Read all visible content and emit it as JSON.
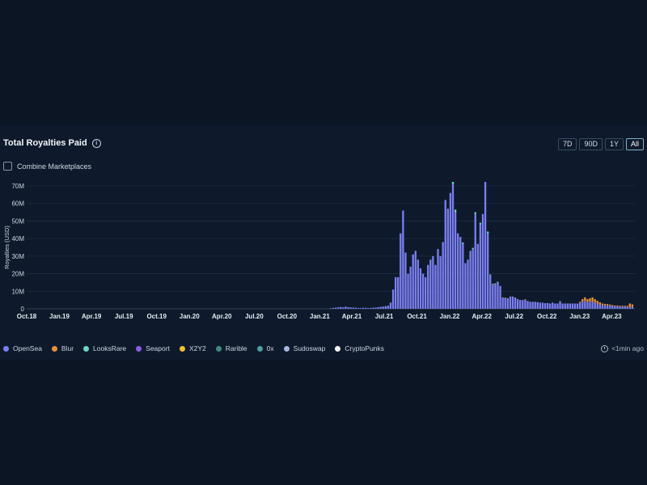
{
  "header": {
    "title": "Total Royalties Paid",
    "info_glyph": "i",
    "ranges": [
      {
        "label": "7D",
        "active": false
      },
      {
        "label": "90D",
        "active": false
      },
      {
        "label": "1Y",
        "active": false
      },
      {
        "label": "All",
        "active": true
      }
    ]
  },
  "combine": {
    "label": "Combine Marketplaces",
    "checked": false
  },
  "footer": {
    "updated": "<1min ago",
    "icon": "clock-refresh-icon"
  },
  "colors": {
    "background": "#0b1524",
    "card": "#0e1a2b",
    "grid": "#1f2d42",
    "OpenSea": "#7b7ff2",
    "Blur": "#e8913b",
    "LooksRare": "#6fd6c6",
    "Seaport": "#8c5ce0",
    "X2Y2": "#f0c02e",
    "Rarible": "#3f8a7c",
    "0x": "#4f9ea1",
    "Sudoswap": "#a7b4de",
    "CryptoPunks": "#f4f4f4"
  },
  "chart_data": {
    "type": "bar",
    "stacked": true,
    "ylabel": "Royalties (USD)",
    "xlabel": "",
    "ylim": [
      0,
      70000000
    ],
    "yticks": [
      {
        "value": 0,
        "label": "0"
      },
      {
        "value": 10000000,
        "label": "10M"
      },
      {
        "value": 20000000,
        "label": "20M"
      },
      {
        "value": 30000000,
        "label": "30M"
      },
      {
        "value": 40000000,
        "label": "40M"
      },
      {
        "value": 50000000,
        "label": "50M"
      },
      {
        "value": 60000000,
        "label": "60M"
      },
      {
        "value": 70000000,
        "label": "70M"
      }
    ],
    "grid": true,
    "xticks": [
      "Oct.18",
      "Jan.19",
      "Apr.19",
      "Jul.19",
      "Oct.19",
      "Jan.20",
      "Apr.20",
      "Jul.20",
      "Oct.20",
      "Jan.21",
      "Apr.21",
      "Jul.21",
      "Oct.21",
      "Jan.22",
      "Apr.22",
      "Jul.22",
      "Oct.22",
      "Jan.23",
      "Apr.23"
    ],
    "x_start": "2018-10-01",
    "x_end": "2023-06-05",
    "bar_interval": "week",
    "legend_position": "bottom",
    "legend": [
      "OpenSea",
      "Blur",
      "LooksRare",
      "Seaport",
      "X2Y2",
      "Rarible",
      "0x",
      "Sudoswap",
      "CryptoPunks"
    ],
    "series": [
      {
        "name": "OpenSea",
        "data": [
          [
            "2021-02-01",
            0.3
          ],
          [
            "2021-02-08",
            0.5
          ],
          [
            "2021-02-15",
            0.6
          ],
          [
            "2021-02-22",
            0.8
          ],
          [
            "2021-03-01",
            1.0
          ],
          [
            "2021-03-08",
            0.8
          ],
          [
            "2021-03-15",
            1.2
          ],
          [
            "2021-03-22",
            0.9
          ],
          [
            "2021-03-29",
            0.8
          ],
          [
            "2021-04-05",
            0.7
          ],
          [
            "2021-04-12",
            0.6
          ],
          [
            "2021-04-19",
            0.5
          ],
          [
            "2021-04-26",
            0.4
          ],
          [
            "2021-05-03",
            0.6
          ],
          [
            "2021-05-10",
            0.5
          ],
          [
            "2021-05-17",
            0.4
          ],
          [
            "2021-05-24",
            0.5
          ],
          [
            "2021-05-31",
            0.6
          ],
          [
            "2021-06-07",
            0.7
          ],
          [
            "2021-06-14",
            0.9
          ],
          [
            "2021-06-21",
            1.1
          ],
          [
            "2021-06-28",
            1.3
          ],
          [
            "2021-07-05",
            1.5
          ],
          [
            "2021-07-12",
            1.8
          ],
          [
            "2021-07-19",
            3.5
          ],
          [
            "2021-07-26",
            11
          ],
          [
            "2021-08-02",
            18
          ],
          [
            "2021-08-09",
            18
          ],
          [
            "2021-08-16",
            43
          ],
          [
            "2021-08-23",
            56
          ],
          [
            "2021-08-30",
            32
          ],
          [
            "2021-09-06",
            20
          ],
          [
            "2021-09-13",
            24
          ],
          [
            "2021-09-20",
            31
          ],
          [
            "2021-09-27",
            33
          ],
          [
            "2021-10-04",
            28
          ],
          [
            "2021-10-11",
            23
          ],
          [
            "2021-10-18",
            20
          ],
          [
            "2021-10-25",
            18
          ],
          [
            "2021-11-01",
            25
          ],
          [
            "2021-11-08",
            28
          ],
          [
            "2021-11-15",
            30
          ],
          [
            "2021-11-22",
            25
          ],
          [
            "2021-11-29",
            34
          ],
          [
            "2021-12-06",
            30
          ],
          [
            "2021-12-13",
            38
          ],
          [
            "2021-12-20",
            62
          ],
          [
            "2021-12-27",
            57
          ],
          [
            "2022-01-03",
            66
          ],
          [
            "2022-01-10",
            71
          ],
          [
            "2022-01-17",
            55
          ],
          [
            "2022-01-24",
            43
          ],
          [
            "2022-01-31",
            41
          ],
          [
            "2022-02-07",
            37
          ],
          [
            "2022-02-14",
            26
          ],
          [
            "2022-02-21",
            28
          ],
          [
            "2022-02-28",
            33
          ],
          [
            "2022-03-07",
            34
          ],
          [
            "2022-03-14",
            54
          ],
          [
            "2022-03-21",
            37
          ],
          [
            "2022-03-28",
            48
          ],
          [
            "2022-04-04",
            54
          ],
          [
            "2022-04-11",
            75
          ],
          [
            "2022-04-18",
            43
          ],
          [
            "2022-04-25",
            19
          ],
          [
            "2022-05-02",
            14
          ],
          [
            "2022-05-09",
            14
          ],
          [
            "2022-05-16",
            15
          ],
          [
            "2022-05-23",
            13
          ],
          [
            "2022-05-30",
            6.5
          ],
          [
            "2022-06-06",
            6
          ],
          [
            "2022-06-13",
            6
          ],
          [
            "2022-06-20",
            7
          ],
          [
            "2022-06-27",
            7
          ],
          [
            "2022-07-04",
            6
          ],
          [
            "2022-07-11",
            5.5
          ],
          [
            "2022-07-18",
            5
          ],
          [
            "2022-07-25",
            5
          ],
          [
            "2022-08-01",
            5
          ],
          [
            "2022-08-08",
            4.5
          ],
          [
            "2022-08-15",
            4
          ],
          [
            "2022-08-22",
            4
          ],
          [
            "2022-08-29",
            4
          ],
          [
            "2022-09-05",
            3.5
          ],
          [
            "2022-09-12",
            3.5
          ],
          [
            "2022-09-19",
            3.5
          ],
          [
            "2022-09-26",
            3.2
          ],
          [
            "2022-10-03",
            3
          ],
          [
            "2022-10-10",
            3
          ],
          [
            "2022-10-17",
            3.5
          ],
          [
            "2022-10-24",
            3
          ],
          [
            "2022-10-31",
            3
          ],
          [
            "2022-11-07",
            4
          ],
          [
            "2022-11-14",
            3
          ],
          [
            "2022-11-21",
            3
          ],
          [
            "2022-11-28",
            3
          ],
          [
            "2022-12-05",
            3
          ],
          [
            "2022-12-12",
            3
          ],
          [
            "2022-12-19",
            3
          ],
          [
            "2022-12-26",
            3
          ],
          [
            "2023-01-02",
            3.5
          ],
          [
            "2023-01-09",
            4
          ],
          [
            "2023-01-16",
            4.5
          ],
          [
            "2023-01-23",
            4
          ],
          [
            "2023-01-30",
            4
          ],
          [
            "2023-02-06",
            4
          ],
          [
            "2023-02-13",
            3.5
          ],
          [
            "2023-02-20",
            3
          ],
          [
            "2023-02-27",
            2.5
          ],
          [
            "2023-03-06",
            2
          ],
          [
            "2023-03-13",
            2
          ],
          [
            "2023-03-20",
            2
          ],
          [
            "2023-03-27",
            1.8
          ],
          [
            "2023-04-03",
            1.6
          ],
          [
            "2023-04-10",
            1.5
          ],
          [
            "2023-04-17",
            1.5
          ],
          [
            "2023-04-24",
            1.3
          ],
          [
            "2023-05-01",
            1.2
          ],
          [
            "2023-05-08",
            1.2
          ],
          [
            "2023-05-15",
            1.2
          ],
          [
            "2023-05-22",
            1
          ],
          [
            "2023-05-29",
            1
          ]
        ]
      },
      {
        "name": "LooksRare",
        "data": [
          [
            "2022-01-10",
            2
          ],
          [
            "2022-01-17",
            1.5
          ],
          [
            "2022-02-07",
            0.8
          ],
          [
            "2022-03-07",
            0.7
          ],
          [
            "2022-03-14",
            1
          ],
          [
            "2022-03-28",
            1
          ],
          [
            "2022-04-11",
            1.2
          ],
          [
            "2022-04-18",
            1
          ],
          [
            "2022-04-25",
            0.5
          ],
          [
            "2022-05-09",
            0.5
          ],
          [
            "2022-05-16",
            0.4
          ]
        ]
      },
      {
        "name": "Blur",
        "data": [
          [
            "2023-01-02",
            0.5
          ],
          [
            "2023-01-09",
            1.5
          ],
          [
            "2023-01-16",
            2
          ],
          [
            "2023-01-23",
            1.5
          ],
          [
            "2023-01-30",
            2
          ],
          [
            "2023-02-06",
            2.5
          ],
          [
            "2023-02-13",
            2
          ],
          [
            "2023-02-20",
            1.5
          ],
          [
            "2023-02-27",
            1.2
          ],
          [
            "2023-03-06",
            1
          ],
          [
            "2023-03-13",
            0.8
          ],
          [
            "2023-03-20",
            0.7
          ],
          [
            "2023-03-27",
            0.6
          ],
          [
            "2023-04-03",
            0.5
          ],
          [
            "2023-04-10",
            0.4
          ],
          [
            "2023-04-17",
            0.4
          ],
          [
            "2023-04-24",
            0.4
          ],
          [
            "2023-05-01",
            0.5
          ],
          [
            "2023-05-08",
            0.5
          ],
          [
            "2023-05-15",
            0.5
          ],
          [
            "2023-05-22",
            2
          ],
          [
            "2023-05-29",
            1.5
          ]
        ]
      },
      {
        "name": "X2Y2",
        "data": [
          [
            "2022-05-02",
            0.3
          ],
          [
            "2022-06-06",
            0.3
          ],
          [
            "2022-07-04",
            0.3
          ],
          [
            "2022-08-01",
            0.3
          ]
        ]
      },
      {
        "name": "Sudoswap",
        "data": [
          [
            "2022-09-05",
            0.2
          ],
          [
            "2022-10-03",
            0.2
          ],
          [
            "2022-11-07",
            0.3
          ]
        ]
      }
    ],
    "value_unit_multiplier": 1000000
  }
}
